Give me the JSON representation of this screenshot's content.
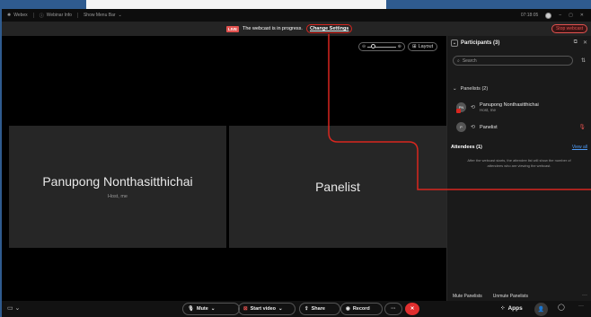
{
  "titlebar": {
    "app_name": "Webex",
    "webinar_info": "Webinar Info",
    "show_menu_bar": "Show Menu Bar",
    "time": "07:18:05"
  },
  "status": {
    "live": "LIVE",
    "message": "The webcast is in progress.",
    "change_settings": "Change Settings",
    "stop_webcast": "Stop webcast"
  },
  "video": {
    "layout_label": "Layout",
    "tiles": [
      {
        "name": "Panupong Nonthasitthichai",
        "sub": "Host, me"
      },
      {
        "name": "Panelist",
        "sub": ""
      }
    ]
  },
  "panel": {
    "title": "Participants (3)",
    "search_placeholder": "Search",
    "panelists_title": "Panelists (2)",
    "panelists": [
      {
        "initials": "PN",
        "name": "Panupong Nonthasitthichai",
        "sub": "Host, me"
      },
      {
        "initials": "P",
        "name": "Panelist",
        "sub": ""
      }
    ],
    "attendees_title": "Attendees (1)",
    "view_all": "View all",
    "attendee_note": "After the webcast starts, the attendee list will show the number of attendees who are viewing the webcast.",
    "mute_panelists": "Mute Panelists",
    "unmute_panelists": "Unmute Panelists"
  },
  "controls": {
    "mute": "Mute",
    "start_video": "Start video",
    "share": "Share",
    "record": "Record",
    "apps": "Apps"
  },
  "colors": {
    "accent_red": "#d8261f",
    "link_blue": "#4e9bf5",
    "desktop_blue": "#2f5b8f"
  }
}
